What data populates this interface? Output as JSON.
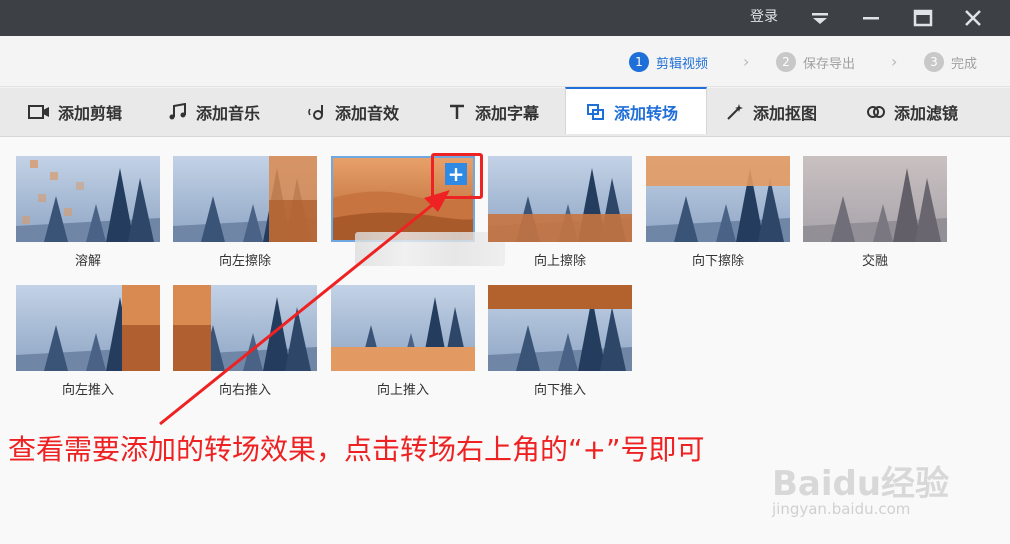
{
  "titlebar": {
    "login": "登录"
  },
  "steps": [
    {
      "num": "1",
      "label": "剪辑视频"
    },
    {
      "num": "2",
      "label": "保存导出"
    },
    {
      "num": "3",
      "label": "完成"
    }
  ],
  "tabs": [
    {
      "label": "添加剪辑",
      "icon": "video-camera-icon"
    },
    {
      "label": "添加音乐",
      "icon": "music-icon"
    },
    {
      "label": "添加音效",
      "icon": "sound-effect-icon"
    },
    {
      "label": "添加字幕",
      "icon": "text-icon"
    },
    {
      "label": "添加转场",
      "icon": "transition-icon"
    },
    {
      "label": "添加抠图",
      "icon": "magic-wand-icon"
    },
    {
      "label": "添加滤镜",
      "icon": "filter-icon"
    }
  ],
  "transitions": [
    {
      "label": "溶解"
    },
    {
      "label": "向左擦除"
    },
    {
      "label": ""
    },
    {
      "label": "向上擦除"
    },
    {
      "label": "向下擦除"
    },
    {
      "label": "交融"
    },
    {
      "label": "向左推入"
    },
    {
      "label": "向右推入"
    },
    {
      "label": "向上推入"
    },
    {
      "label": "向下推入"
    }
  ],
  "plus_button": "+",
  "annotation": "查看需要添加的转场效果，点击转场右上角的“+”号即可",
  "watermark": {
    "brand": "Baidu经验",
    "url": "jingyan.baidu.com"
  },
  "colors": {
    "accent": "#1f6fd8",
    "annotation": "#ee2222",
    "plus": "#2f8ae5"
  }
}
